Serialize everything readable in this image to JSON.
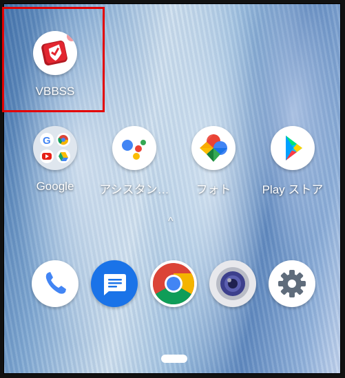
{
  "home": {
    "apps": [
      {
        "label": "VBBSS",
        "icon": "vbbss-shield-icon"
      },
      {
        "label": "Google",
        "icon": "google-folder-icon"
      },
      {
        "label": "アシスタン…",
        "icon": "assistant-icon"
      },
      {
        "label": "フォト",
        "icon": "photos-icon"
      },
      {
        "label": "Play ストア",
        "icon": "play-store-icon"
      }
    ],
    "drawer_arrow": "^",
    "dock": [
      {
        "icon": "phone-icon"
      },
      {
        "icon": "messages-icon"
      },
      {
        "icon": "chrome-icon"
      },
      {
        "icon": "camera-icon"
      },
      {
        "icon": "settings-icon"
      }
    ]
  },
  "colors": {
    "highlight": "#e30000",
    "vbbss_red": "#d9202a"
  }
}
